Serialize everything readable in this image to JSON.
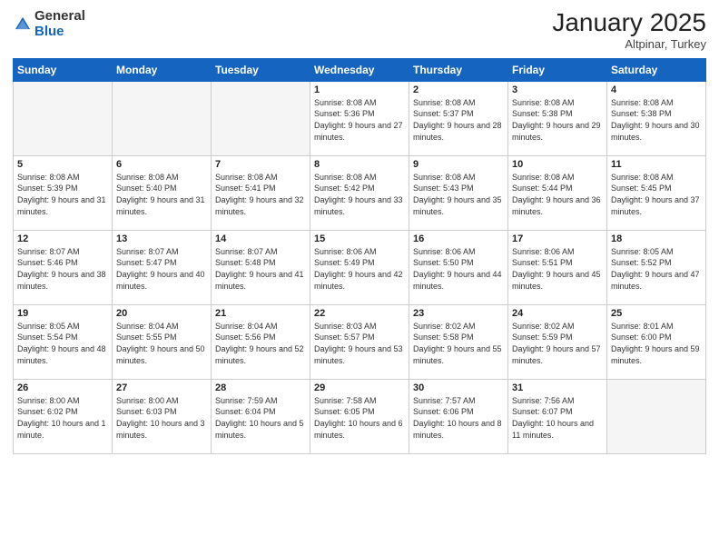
{
  "header": {
    "logo_general": "General",
    "logo_blue": "Blue",
    "month_title": "January 2025",
    "subtitle": "Altpinar, Turkey"
  },
  "weekdays": [
    "Sunday",
    "Monday",
    "Tuesday",
    "Wednesday",
    "Thursday",
    "Friday",
    "Saturday"
  ],
  "weeks": [
    [
      {
        "day": "",
        "info": ""
      },
      {
        "day": "",
        "info": ""
      },
      {
        "day": "",
        "info": ""
      },
      {
        "day": "1",
        "info": "Sunrise: 8:08 AM\nSunset: 5:36 PM\nDaylight: 9 hours and 27 minutes."
      },
      {
        "day": "2",
        "info": "Sunrise: 8:08 AM\nSunset: 5:37 PM\nDaylight: 9 hours and 28 minutes."
      },
      {
        "day": "3",
        "info": "Sunrise: 8:08 AM\nSunset: 5:38 PM\nDaylight: 9 hours and 29 minutes."
      },
      {
        "day": "4",
        "info": "Sunrise: 8:08 AM\nSunset: 5:38 PM\nDaylight: 9 hours and 30 minutes."
      }
    ],
    [
      {
        "day": "5",
        "info": "Sunrise: 8:08 AM\nSunset: 5:39 PM\nDaylight: 9 hours and 31 minutes."
      },
      {
        "day": "6",
        "info": "Sunrise: 8:08 AM\nSunset: 5:40 PM\nDaylight: 9 hours and 31 minutes."
      },
      {
        "day": "7",
        "info": "Sunrise: 8:08 AM\nSunset: 5:41 PM\nDaylight: 9 hours and 32 minutes."
      },
      {
        "day": "8",
        "info": "Sunrise: 8:08 AM\nSunset: 5:42 PM\nDaylight: 9 hours and 33 minutes."
      },
      {
        "day": "9",
        "info": "Sunrise: 8:08 AM\nSunset: 5:43 PM\nDaylight: 9 hours and 35 minutes."
      },
      {
        "day": "10",
        "info": "Sunrise: 8:08 AM\nSunset: 5:44 PM\nDaylight: 9 hours and 36 minutes."
      },
      {
        "day": "11",
        "info": "Sunrise: 8:08 AM\nSunset: 5:45 PM\nDaylight: 9 hours and 37 minutes."
      }
    ],
    [
      {
        "day": "12",
        "info": "Sunrise: 8:07 AM\nSunset: 5:46 PM\nDaylight: 9 hours and 38 minutes."
      },
      {
        "day": "13",
        "info": "Sunrise: 8:07 AM\nSunset: 5:47 PM\nDaylight: 9 hours and 40 minutes."
      },
      {
        "day": "14",
        "info": "Sunrise: 8:07 AM\nSunset: 5:48 PM\nDaylight: 9 hours and 41 minutes."
      },
      {
        "day": "15",
        "info": "Sunrise: 8:06 AM\nSunset: 5:49 PM\nDaylight: 9 hours and 42 minutes."
      },
      {
        "day": "16",
        "info": "Sunrise: 8:06 AM\nSunset: 5:50 PM\nDaylight: 9 hours and 44 minutes."
      },
      {
        "day": "17",
        "info": "Sunrise: 8:06 AM\nSunset: 5:51 PM\nDaylight: 9 hours and 45 minutes."
      },
      {
        "day": "18",
        "info": "Sunrise: 8:05 AM\nSunset: 5:52 PM\nDaylight: 9 hours and 47 minutes."
      }
    ],
    [
      {
        "day": "19",
        "info": "Sunrise: 8:05 AM\nSunset: 5:54 PM\nDaylight: 9 hours and 48 minutes."
      },
      {
        "day": "20",
        "info": "Sunrise: 8:04 AM\nSunset: 5:55 PM\nDaylight: 9 hours and 50 minutes."
      },
      {
        "day": "21",
        "info": "Sunrise: 8:04 AM\nSunset: 5:56 PM\nDaylight: 9 hours and 52 minutes."
      },
      {
        "day": "22",
        "info": "Sunrise: 8:03 AM\nSunset: 5:57 PM\nDaylight: 9 hours and 53 minutes."
      },
      {
        "day": "23",
        "info": "Sunrise: 8:02 AM\nSunset: 5:58 PM\nDaylight: 9 hours and 55 minutes."
      },
      {
        "day": "24",
        "info": "Sunrise: 8:02 AM\nSunset: 5:59 PM\nDaylight: 9 hours and 57 minutes."
      },
      {
        "day": "25",
        "info": "Sunrise: 8:01 AM\nSunset: 6:00 PM\nDaylight: 9 hours and 59 minutes."
      }
    ],
    [
      {
        "day": "26",
        "info": "Sunrise: 8:00 AM\nSunset: 6:02 PM\nDaylight: 10 hours and 1 minute."
      },
      {
        "day": "27",
        "info": "Sunrise: 8:00 AM\nSunset: 6:03 PM\nDaylight: 10 hours and 3 minutes."
      },
      {
        "day": "28",
        "info": "Sunrise: 7:59 AM\nSunset: 6:04 PM\nDaylight: 10 hours and 5 minutes."
      },
      {
        "day": "29",
        "info": "Sunrise: 7:58 AM\nSunset: 6:05 PM\nDaylight: 10 hours and 6 minutes."
      },
      {
        "day": "30",
        "info": "Sunrise: 7:57 AM\nSunset: 6:06 PM\nDaylight: 10 hours and 8 minutes."
      },
      {
        "day": "31",
        "info": "Sunrise: 7:56 AM\nSunset: 6:07 PM\nDaylight: 10 hours and 11 minutes."
      },
      {
        "day": "",
        "info": ""
      }
    ]
  ]
}
